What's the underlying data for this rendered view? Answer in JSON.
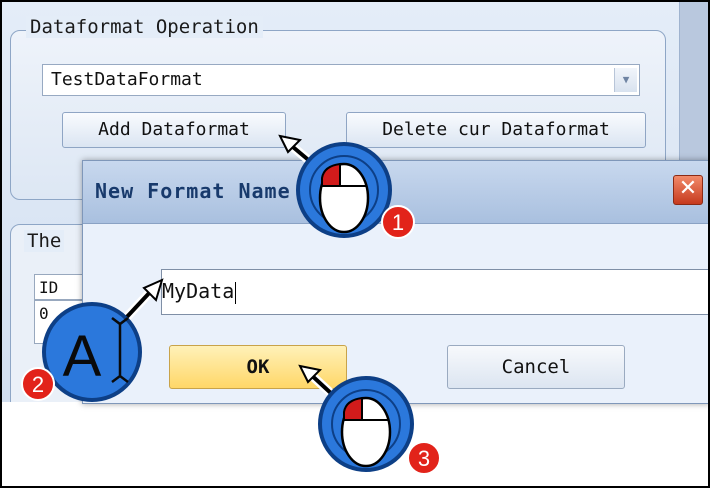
{
  "background_window": {
    "group_title": "Dataformat Operation",
    "combo_value": "TestDataFormat",
    "add_button_label": "Add Dataformat",
    "delete_button_label": "Delete cur Dataformat",
    "group2_title": "The",
    "grid_header": "ID",
    "grid_first_cell": "0"
  },
  "dialog": {
    "title": "New Format Name Dialog",
    "close_glyph": "✕",
    "input_value": "MyData",
    "ok_label": "OK",
    "cancel_label": "Cancel"
  },
  "annotations": {
    "steps": [
      {
        "number": "1",
        "icon": "mouse-click-icon"
      },
      {
        "number": "2",
        "icon": "text-cursor-icon",
        "glyph": "A"
      },
      {
        "number": "3",
        "icon": "mouse-click-icon"
      }
    ],
    "colors": {
      "badge": "#e2231a",
      "ring": "#1f6fd1",
      "mouse_button": "#d11b1b"
    }
  }
}
